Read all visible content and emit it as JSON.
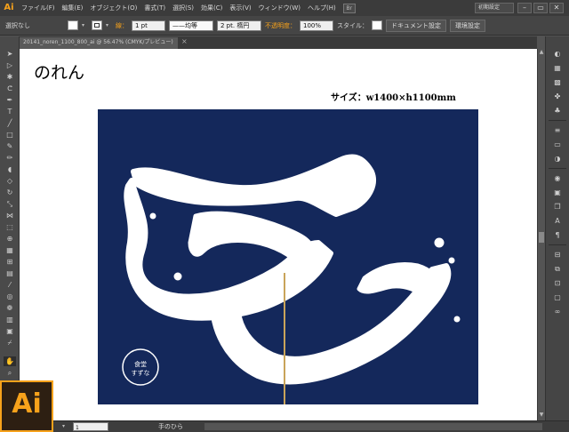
{
  "app": {
    "logo": "Ai",
    "menu": [
      "ファイル(F)",
      "編集(E)",
      "オブジェクト(O)",
      "書式(T)",
      "選択(S)",
      "効果(C)",
      "表示(V)",
      "ウィンドウ(W)",
      "ヘルプ(H)"
    ],
    "bridge_label": "Br",
    "workspace": "初期設定",
    "window_buttons": [
      "–",
      "▭",
      "✕"
    ]
  },
  "control_bar": {
    "selection": "選択なし",
    "stroke_label": "線：",
    "stroke_width": "1 pt",
    "stroke_profile": "均等",
    "brush": "2 pt. 楕円",
    "opacity_label": "不透明度：",
    "opacity_value": "100%",
    "style_label": "スタイル：",
    "document_setup": "ドキュメント設定",
    "preferences": "環境設定"
  },
  "document": {
    "tab_name": "20141_noren_1100_800_ai @ 56.47% (CMYK/プレビュー)",
    "title": "のれん",
    "size_label": "サイズ：w1400×h1100mm",
    "noren_color": "#14285b",
    "seal_line1": "食堂",
    "seal_line2": "すずな"
  },
  "tools": [
    "selection-icon",
    "direct-selection-icon",
    "magic-wand-icon",
    "lasso-icon",
    "pen-icon",
    "type-icon",
    "line-icon",
    "rectangle-icon",
    "paintbrush-icon",
    "pencil-icon",
    "blob-brush-icon",
    "eraser-icon",
    "rotate-icon",
    "scale-icon",
    "width-icon",
    "free-transform-icon",
    "shape-builder-icon",
    "perspective-icon",
    "mesh-icon",
    "gradient-icon",
    "eyedropper-icon",
    "blend-icon",
    "symbol-sprayer-icon",
    "column-graph-icon",
    "artboard-icon",
    "slice-icon",
    "hand-icon",
    "zoom-icon"
  ],
  "status": {
    "zoom_value": "56.47%",
    "page": "1",
    "tool_name": "手のひら"
  },
  "badge": "Ai"
}
